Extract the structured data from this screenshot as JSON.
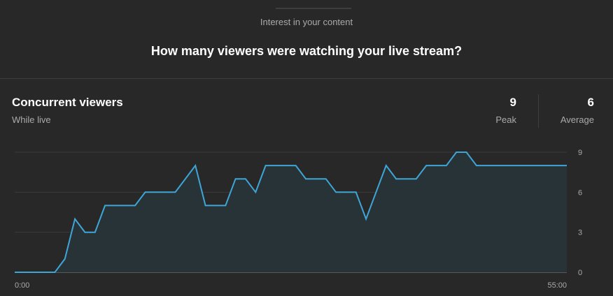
{
  "header": {
    "label": "Interest in your content",
    "question": "How many viewers were watching your live stream?"
  },
  "card": {
    "title": "Concurrent viewers",
    "subtitle": "While live",
    "stats": {
      "peak_value": "9",
      "peak_label": "Peak",
      "average_value": "6",
      "average_label": "Average"
    }
  },
  "colors": {
    "background": "#282828",
    "line": "#3ea6d6",
    "fill": "#283338"
  },
  "chart_data": {
    "type": "area",
    "title": "Concurrent viewers",
    "x_tick_labels": [
      "0:00",
      "55:00"
    ],
    "xlim": [
      0,
      55
    ],
    "ylim": [
      0,
      9
    ],
    "y_ticks": [
      0,
      3,
      6,
      9
    ],
    "grid": true,
    "y_axis_side": "right",
    "series": [
      {
        "x": [
          0,
          1,
          2,
          3,
          4,
          5,
          6,
          7,
          8,
          9,
          10,
          11,
          12,
          13,
          14,
          15,
          16,
          17,
          18,
          19,
          20,
          21,
          22,
          23,
          24,
          25,
          26,
          27,
          28,
          29,
          30,
          31,
          32,
          33,
          34,
          35,
          36,
          37,
          38,
          39,
          40,
          41,
          42,
          43,
          44,
          45,
          46,
          47,
          48,
          49,
          50,
          51,
          52,
          53,
          54,
          55
        ],
        "values": [
          0,
          0,
          0,
          0,
          0,
          1,
          4,
          3,
          3,
          5,
          5,
          5,
          5,
          6,
          6,
          6,
          6,
          7,
          8,
          5,
          5,
          5,
          7,
          7,
          6,
          8,
          8,
          8,
          8,
          7,
          7,
          7,
          6,
          6,
          6,
          4,
          6,
          8,
          7,
          7,
          7,
          8,
          8,
          8,
          9,
          9,
          8,
          8,
          8,
          8,
          8,
          8,
          8,
          8,
          8,
          8
        ]
      }
    ]
  }
}
